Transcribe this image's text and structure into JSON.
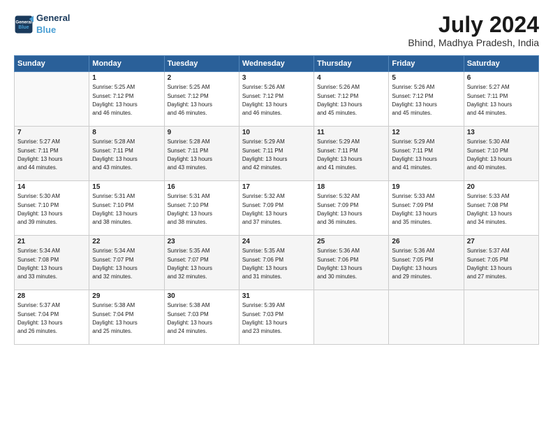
{
  "header": {
    "logo_line1": "General",
    "logo_line2": "Blue",
    "month_year": "July 2024",
    "location": "Bhind, Madhya Pradesh, India"
  },
  "weekdays": [
    "Sunday",
    "Monday",
    "Tuesday",
    "Wednesday",
    "Thursday",
    "Friday",
    "Saturday"
  ],
  "weeks": [
    [
      {
        "day": "",
        "info": ""
      },
      {
        "day": "1",
        "info": "Sunrise: 5:25 AM\nSunset: 7:12 PM\nDaylight: 13 hours\nand 46 minutes."
      },
      {
        "day": "2",
        "info": "Sunrise: 5:25 AM\nSunset: 7:12 PM\nDaylight: 13 hours\nand 46 minutes."
      },
      {
        "day": "3",
        "info": "Sunrise: 5:26 AM\nSunset: 7:12 PM\nDaylight: 13 hours\nand 46 minutes."
      },
      {
        "day": "4",
        "info": "Sunrise: 5:26 AM\nSunset: 7:12 PM\nDaylight: 13 hours\nand 45 minutes."
      },
      {
        "day": "5",
        "info": "Sunrise: 5:26 AM\nSunset: 7:12 PM\nDaylight: 13 hours\nand 45 minutes."
      },
      {
        "day": "6",
        "info": "Sunrise: 5:27 AM\nSunset: 7:11 PM\nDaylight: 13 hours\nand 44 minutes."
      }
    ],
    [
      {
        "day": "7",
        "info": "Sunrise: 5:27 AM\nSunset: 7:11 PM\nDaylight: 13 hours\nand 44 minutes."
      },
      {
        "day": "8",
        "info": "Sunrise: 5:28 AM\nSunset: 7:11 PM\nDaylight: 13 hours\nand 43 minutes."
      },
      {
        "day": "9",
        "info": "Sunrise: 5:28 AM\nSunset: 7:11 PM\nDaylight: 13 hours\nand 43 minutes."
      },
      {
        "day": "10",
        "info": "Sunrise: 5:29 AM\nSunset: 7:11 PM\nDaylight: 13 hours\nand 42 minutes."
      },
      {
        "day": "11",
        "info": "Sunrise: 5:29 AM\nSunset: 7:11 PM\nDaylight: 13 hours\nand 41 minutes."
      },
      {
        "day": "12",
        "info": "Sunrise: 5:29 AM\nSunset: 7:11 PM\nDaylight: 13 hours\nand 41 minutes."
      },
      {
        "day": "13",
        "info": "Sunrise: 5:30 AM\nSunset: 7:10 PM\nDaylight: 13 hours\nand 40 minutes."
      }
    ],
    [
      {
        "day": "14",
        "info": "Sunrise: 5:30 AM\nSunset: 7:10 PM\nDaylight: 13 hours\nand 39 minutes."
      },
      {
        "day": "15",
        "info": "Sunrise: 5:31 AM\nSunset: 7:10 PM\nDaylight: 13 hours\nand 38 minutes."
      },
      {
        "day": "16",
        "info": "Sunrise: 5:31 AM\nSunset: 7:10 PM\nDaylight: 13 hours\nand 38 minutes."
      },
      {
        "day": "17",
        "info": "Sunrise: 5:32 AM\nSunset: 7:09 PM\nDaylight: 13 hours\nand 37 minutes."
      },
      {
        "day": "18",
        "info": "Sunrise: 5:32 AM\nSunset: 7:09 PM\nDaylight: 13 hours\nand 36 minutes."
      },
      {
        "day": "19",
        "info": "Sunrise: 5:33 AM\nSunset: 7:09 PM\nDaylight: 13 hours\nand 35 minutes."
      },
      {
        "day": "20",
        "info": "Sunrise: 5:33 AM\nSunset: 7:08 PM\nDaylight: 13 hours\nand 34 minutes."
      }
    ],
    [
      {
        "day": "21",
        "info": "Sunrise: 5:34 AM\nSunset: 7:08 PM\nDaylight: 13 hours\nand 33 minutes."
      },
      {
        "day": "22",
        "info": "Sunrise: 5:34 AM\nSunset: 7:07 PM\nDaylight: 13 hours\nand 32 minutes."
      },
      {
        "day": "23",
        "info": "Sunrise: 5:35 AM\nSunset: 7:07 PM\nDaylight: 13 hours\nand 32 minutes."
      },
      {
        "day": "24",
        "info": "Sunrise: 5:35 AM\nSunset: 7:06 PM\nDaylight: 13 hours\nand 31 minutes."
      },
      {
        "day": "25",
        "info": "Sunrise: 5:36 AM\nSunset: 7:06 PM\nDaylight: 13 hours\nand 30 minutes."
      },
      {
        "day": "26",
        "info": "Sunrise: 5:36 AM\nSunset: 7:05 PM\nDaylight: 13 hours\nand 29 minutes."
      },
      {
        "day": "27",
        "info": "Sunrise: 5:37 AM\nSunset: 7:05 PM\nDaylight: 13 hours\nand 27 minutes."
      }
    ],
    [
      {
        "day": "28",
        "info": "Sunrise: 5:37 AM\nSunset: 7:04 PM\nDaylight: 13 hours\nand 26 minutes."
      },
      {
        "day": "29",
        "info": "Sunrise: 5:38 AM\nSunset: 7:04 PM\nDaylight: 13 hours\nand 25 minutes."
      },
      {
        "day": "30",
        "info": "Sunrise: 5:38 AM\nSunset: 7:03 PM\nDaylight: 13 hours\nand 24 minutes."
      },
      {
        "day": "31",
        "info": "Sunrise: 5:39 AM\nSunset: 7:03 PM\nDaylight: 13 hours\nand 23 minutes."
      },
      {
        "day": "",
        "info": ""
      },
      {
        "day": "",
        "info": ""
      },
      {
        "day": "",
        "info": ""
      }
    ]
  ]
}
